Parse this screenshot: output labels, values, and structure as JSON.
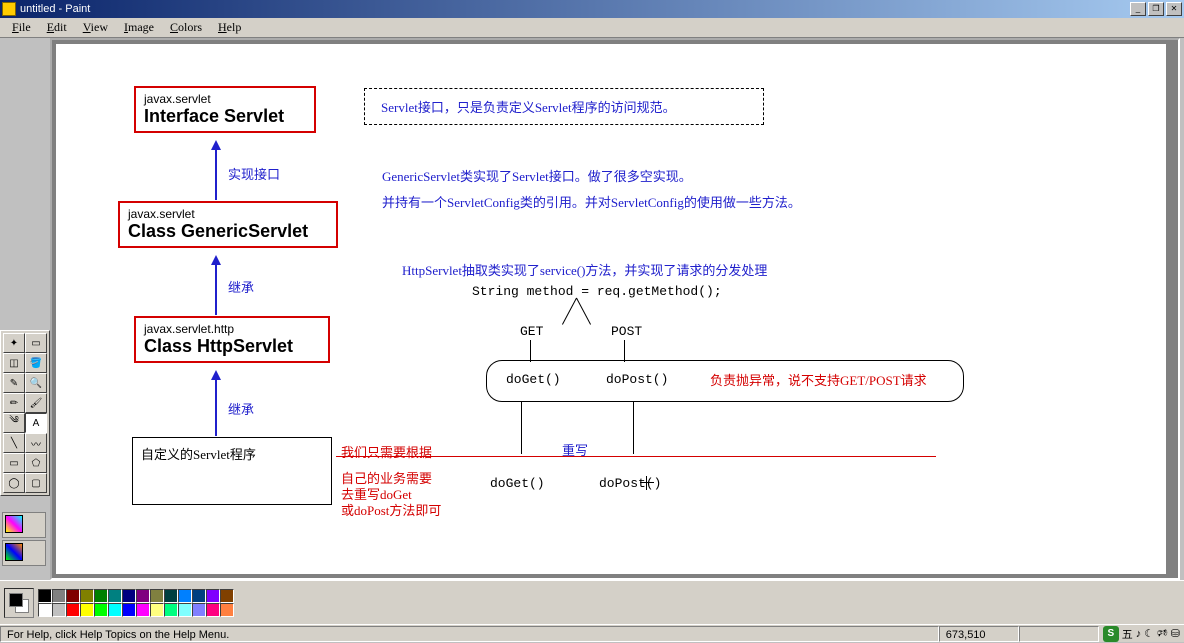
{
  "titlebar": {
    "title": "untitled - Paint"
  },
  "menu": {
    "items": [
      "File",
      "Edit",
      "View",
      "Image",
      "Colors",
      "Help"
    ]
  },
  "toolbox": {
    "tools": [
      {
        "name": "free-select-icon",
        "glyph": "✦"
      },
      {
        "name": "rect-select-icon",
        "glyph": "▭"
      },
      {
        "name": "eraser-icon",
        "glyph": "◫"
      },
      {
        "name": "fill-icon",
        "glyph": "🪣"
      },
      {
        "name": "picker-icon",
        "glyph": "✎"
      },
      {
        "name": "magnifier-icon",
        "glyph": "🔍"
      },
      {
        "name": "pencil-icon",
        "glyph": "✏"
      },
      {
        "name": "brush-icon",
        "glyph": "🖌"
      },
      {
        "name": "airbrush-icon",
        "glyph": "༄"
      },
      {
        "name": "text-icon",
        "glyph": "A"
      },
      {
        "name": "line-icon",
        "glyph": "╲"
      },
      {
        "name": "curve-icon",
        "glyph": "〰"
      },
      {
        "name": "rect-icon",
        "glyph": "▭"
      },
      {
        "name": "polygon-icon",
        "glyph": "⬠"
      },
      {
        "name": "ellipse-icon",
        "glyph": "◯"
      },
      {
        "name": "rounded-rect-icon",
        "glyph": "▢"
      }
    ]
  },
  "palette": {
    "row1": [
      "#000000",
      "#808080",
      "#800000",
      "#808000",
      "#008000",
      "#008080",
      "#000080",
      "#800080",
      "#808040",
      "#004040",
      "#0080ff",
      "#004080",
      "#8000ff",
      "#804000"
    ],
    "row2": [
      "#ffffff",
      "#c0c0c0",
      "#ff0000",
      "#ffff00",
      "#00ff00",
      "#00ffff",
      "#0000ff",
      "#ff00ff",
      "#ffff80",
      "#00ff80",
      "#80ffff",
      "#8080ff",
      "#ff0080",
      "#ff8040"
    ]
  },
  "statusbar": {
    "help": "For Help, click Help Topics on the Help Menu.",
    "coords": "673,510",
    "ime_label": "五"
  },
  "diagram": {
    "box1": {
      "pkg": "javax.servlet",
      "cls": "Interface Servlet"
    },
    "box2": {
      "pkg": "javax.servlet",
      "cls": "Class GenericServlet"
    },
    "box3": {
      "pkg": "javax.servlet.http",
      "cls": "Class HttpServlet"
    },
    "box4": "自定义的Servlet程序",
    "arrow1_label": "实现接口",
    "arrow2_label": "继承",
    "arrow3_label": "继承",
    "note1": "Servlet接口，只是负责定义Servlet程序的访问规范。",
    "note2_line1": "GenericServlet类实现了Servlet接口。做了很多空实现。",
    "note2_line2": "并持有一个ServletConfig类的引用。并对ServletConfig的使用做一些方法。",
    "note3": "HttpServlet抽取类实现了service()方法，并实现了请求的分发处理",
    "code1": "String method = req.getMethod();",
    "branch_get": "GET",
    "branch_post": "POST",
    "doGet": "doGet()",
    "doPost": "doPost()",
    "err_note": "负责抛异常，说不支持GET/POST请求",
    "override_label": "重写",
    "doGet2": "doGet()",
    "doPost2": "doPost()",
    "red_note_line1": "我们只需要根据",
    "red_note_line2": "自己的业务需要",
    "red_note_line3": "去重写doGet",
    "red_note_line4": "或doPost方法即可"
  }
}
